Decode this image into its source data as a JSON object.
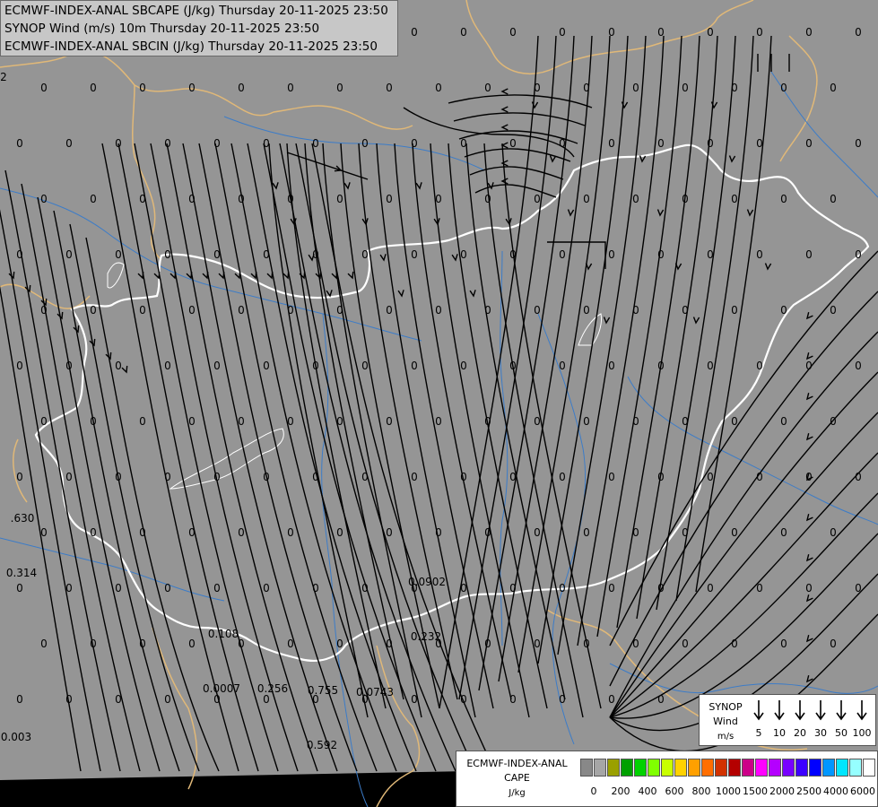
{
  "header": {
    "line1": "ECMWF-INDEX-ANAL SBCAPE (J/kg) Thursday 20-11-2025 23:50",
    "line2": "SYNOP Wind (m/s) 10m Thursday 20-11-2025 23:50",
    "line3": "ECMWF-INDEX-ANAL SBCIN (J/kg) Thursday 20-11-2025 23:50"
  },
  "map_labels": {
    "zero": "0",
    "v_2": "2",
    "v_630": ".630",
    "v_314": "0.314",
    "v_0902": "0.0902",
    "v_232": "0.232",
    "v_108": "0.108",
    "v_0007": "0.0007",
    "v_256": "0.256",
    "v_755": "0.755",
    "v_0743": "0.0743",
    "v_003": "0.003",
    "v_592": "0.592"
  },
  "synop_legend": {
    "title": "SYNOP",
    "subtitle": "Wind",
    "unit": "m/s",
    "speeds": [
      "5",
      "10",
      "20",
      "30",
      "50",
      "100"
    ]
  },
  "cape_legend": {
    "title": "ECMWF-INDEX-ANAL",
    "subtitle": "CAPE",
    "unit": "J/kg",
    "ticks": [
      "0",
      "200",
      "400",
      "600",
      "800",
      "1000",
      "1500",
      "2000",
      "2500",
      "4000",
      "6000"
    ],
    "colors": [
      "#888888",
      "#a6a6a6",
      "#9aa000",
      "#00a000",
      "#00d200",
      "#80ff00",
      "#c8ff00",
      "#ffd200",
      "#ffa000",
      "#ff6e00",
      "#d23200",
      "#b40000",
      "#cc0088",
      "#ff00ff",
      "#b400ff",
      "#7800ff",
      "#3c00ff",
      "#0000ff",
      "#0096ff",
      "#00e6ff",
      "#96ffff",
      "#ffffff"
    ]
  },
  "colors": {
    "background": "#959595",
    "border_country": "#ffffff",
    "border_outer": "#e0b878",
    "river": "#3c7cc8",
    "streamline": "#000000"
  }
}
